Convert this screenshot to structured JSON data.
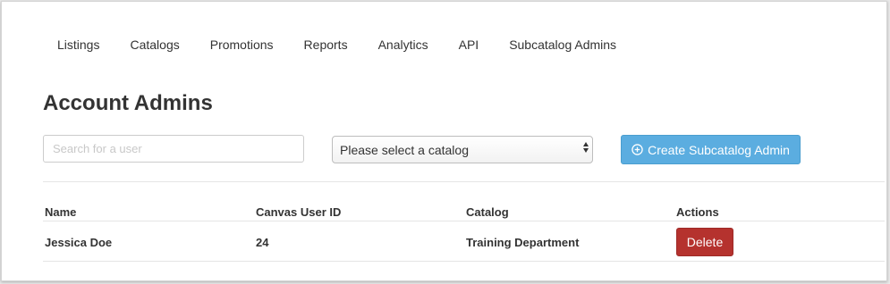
{
  "nav": {
    "items": [
      {
        "label": "Listings"
      },
      {
        "label": "Catalogs"
      },
      {
        "label": "Promotions"
      },
      {
        "label": "Reports"
      },
      {
        "label": "Analytics"
      },
      {
        "label": "API"
      },
      {
        "label": "Subcatalog Admins"
      }
    ]
  },
  "page": {
    "title": "Account Admins"
  },
  "search": {
    "placeholder": "Search for a user",
    "value": ""
  },
  "catalog_select": {
    "selected": "Please select a catalog"
  },
  "create_button": {
    "label": "Create Subcatalog Admin",
    "icon": "plus-circle-icon"
  },
  "table": {
    "columns": [
      "Name",
      "Canvas User ID",
      "Catalog",
      "Actions"
    ],
    "rows": [
      {
        "name": "Jessica Doe",
        "canvas_user_id": "24",
        "catalog": "Training Department",
        "action_label": "Delete"
      }
    ]
  },
  "colors": {
    "primary_button": "#5bade0",
    "danger_button": "#b5322e",
    "text": "#333333"
  }
}
